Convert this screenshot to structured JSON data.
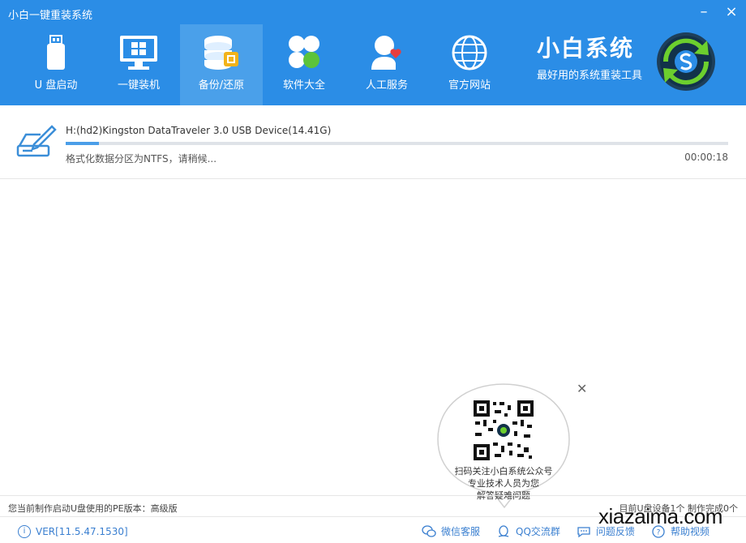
{
  "app": {
    "title": "小白一键重装系统"
  },
  "window": {
    "minimize": "–",
    "close": "×"
  },
  "nav": [
    {
      "label": "U 盘启动",
      "icon": "usb-drive-icon",
      "active": false
    },
    {
      "label": "一键装机",
      "icon": "windows-monitor-icon",
      "active": false
    },
    {
      "label": "备份/还原",
      "icon": "database-backup-icon",
      "active": true
    },
    {
      "label": "软件大全",
      "icon": "clover-apps-icon",
      "active": false
    },
    {
      "label": "人工服务",
      "icon": "support-person-heart-icon",
      "active": false
    },
    {
      "label": "官方网站",
      "icon": "globe-icon",
      "active": false
    }
  ],
  "brand": {
    "name": "小白系统",
    "slogan": "最好用的系统重装工具"
  },
  "task": {
    "device": "H:(hd2)Kingston DataTraveler 3.0 USB Device(14.41G)",
    "status": "格式化数据分区为NTFS，请稍候...",
    "elapsed": "00:00:18",
    "progress": 0.05
  },
  "footer": {
    "pe_version": "您当前制作启动U盘使用的PE版本：高级版",
    "device_count": "目前U盘设备1个 制作完成0个",
    "version": "VER[11.5.47.1530]",
    "links": [
      {
        "label": "微信客服",
        "icon": "wechat-icon"
      },
      {
        "label": "QQ交流群",
        "icon": "qq-icon"
      },
      {
        "label": "问题反馈",
        "icon": "feedback-chat-icon"
      },
      {
        "label": "帮助视频",
        "icon": "help-icon"
      }
    ]
  },
  "popup": {
    "line1": "扫码关注小白系统公众号",
    "line2": "专业技术人员为您",
    "line3": "解答疑难问题",
    "close": "✕"
  },
  "watermark": "xiazaima.com",
  "colors": {
    "header": "#2b8de6",
    "active_tab": "#4aa0ea",
    "accent": "#3a7fd0",
    "progress": "#4b9ee8"
  }
}
